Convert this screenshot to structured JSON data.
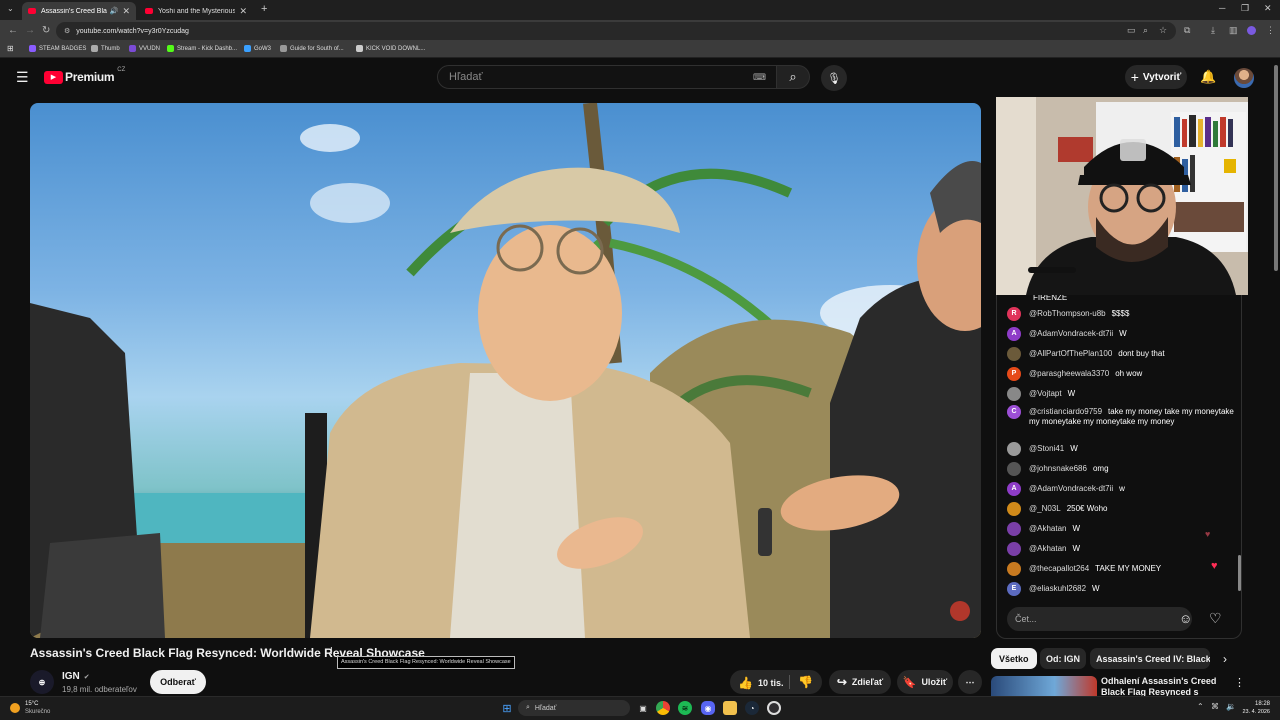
{
  "browser": {
    "tabs": [
      {
        "title": "Assassin's Creed Black Flag",
        "active": true
      },
      {
        "title": "Yoshi and the Mysterious Book",
        "active": false
      }
    ],
    "url": "youtube.com/watch?v=y3r0Yzcudag",
    "bookmarks": [
      {
        "label": "STEAM BADGES",
        "color": "#8a5cff"
      },
      {
        "label": "Thumb",
        "color": "#aaaaaa"
      },
      {
        "label": "VVUDN",
        "color": "#7b4bd6"
      },
      {
        "label": "Stream - Kick Dashb...",
        "color": "#53fc18"
      },
      {
        "label": "GoW3",
        "color": "#3aa0ff"
      },
      {
        "label": "Guide for South of...",
        "color": "#999999"
      },
      {
        "label": "KICK VOID DOWNL...",
        "color": "#cccccc"
      }
    ]
  },
  "youtube": {
    "logo_text": "Premium",
    "region": "CZ",
    "search_placeholder": "Hľadať",
    "create_label": "Vytvoriť"
  },
  "video": {
    "title": "Assassin's Creed Black Flag Resynced: Worldwide Reveal Showcase",
    "tooltip": "Assassin's Creed Black Flag Resynced: Worldwide Reveal Showcase",
    "channel": "IGN",
    "subscribers": "19,8 mil. odberateľov",
    "subscribe_label": "Odberať",
    "likes": "10 tis.",
    "share_label": "Zdieľať",
    "save_label": "Uložiť"
  },
  "chat": {
    "partial_top": "FIRENZE",
    "messages": [
      {
        "author": "@RobThompson-u8b",
        "text": "$$$$",
        "avatar": "R",
        "color": "#e0345a"
      },
      {
        "author": "@AdamVondracek-dt7ii",
        "text": "W",
        "avatar": "A",
        "color": "#8e3cc8"
      },
      {
        "author": "@AllPartOfThePlan100",
        "text": "dont buy that",
        "avatar": "",
        "color": "#6b5a3a"
      },
      {
        "author": "@parasgheewala3370",
        "text": "oh wow",
        "avatar": "P",
        "color": "#e64a19"
      },
      {
        "author": "@Vojtapt",
        "text": "W",
        "avatar": "",
        "color": "#888888"
      },
      {
        "author": "@cristianciardo9759",
        "text": "take my money take my moneytake my moneytake my moneytake my money",
        "avatar": "C",
        "color": "#9c4fd6"
      },
      {
        "author": "@Stoni41",
        "text": "W",
        "avatar": "",
        "color": "#9a9a9a"
      },
      {
        "author": "@johnsnake686",
        "text": "omg",
        "avatar": "",
        "color": "#555555"
      },
      {
        "author": "@AdamVondracek-dt7ii",
        "text": "w",
        "avatar": "A",
        "color": "#8e3cc8"
      },
      {
        "author": "@_N03L",
        "text": "250€ Woho",
        "avatar": "",
        "color": "#d08a1a"
      },
      {
        "author": "@Akhatan",
        "text": "W",
        "avatar": "",
        "color": "#7a3fa8"
      },
      {
        "author": "@Akhatan",
        "text": "W",
        "avatar": "",
        "color": "#7a3fa8"
      },
      {
        "author": "@thecapallot264",
        "text": "TAKE MY MONEY",
        "avatar": "",
        "color": "#c87a20"
      },
      {
        "author": "@eliaskuhl2682",
        "text": "W",
        "avatar": "E",
        "color": "#5c6bc0"
      }
    ],
    "input_placeholder": "Čet..."
  },
  "related": {
    "chips": [
      "Všetko",
      "Od: IGN",
      "Assassin's Creed IV: Black Fl"
    ],
    "first_title": "Odhalení Assassin's Creed Black Flag Resynced s českým"
  },
  "taskbar": {
    "weather_temp": "15°C",
    "weather_desc": "Skurečno",
    "search_label": "Hľadať",
    "time": "18:28",
    "date": "23. 4. 2026"
  }
}
